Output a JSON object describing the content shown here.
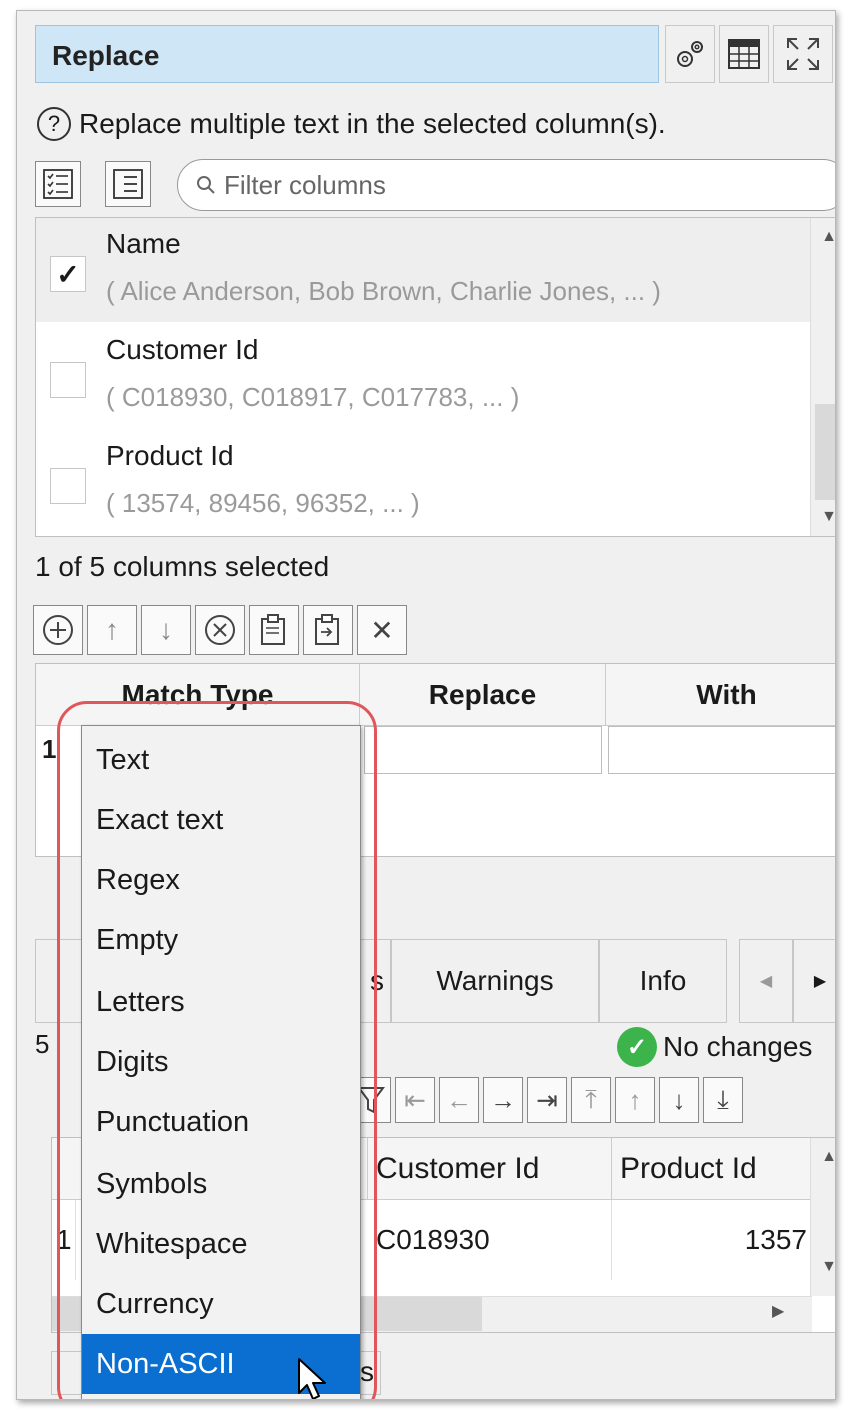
{
  "header": {
    "title": "Replace"
  },
  "help": {
    "icon": "?",
    "text": "Replace multiple text in the selected column(s)."
  },
  "filter": {
    "placeholder": "Filter columns"
  },
  "columns": [
    {
      "name": "Name",
      "sample": "( Alice Anderson, Bob Brown, Charlie Jones, ... )",
      "checked": true,
      "check_glyph": "✓"
    },
    {
      "name": "Customer Id",
      "sample": "( C018930, C018917, C017783, ... )",
      "checked": false,
      "check_glyph": ""
    },
    {
      "name": "Product Id",
      "sample": "( 13574, 89456, 96352, ... )",
      "checked": false,
      "check_glyph": ""
    }
  ],
  "selection_status": "1 of 5 columns selected",
  "rules_grid": {
    "headers": [
      "Match Type",
      "Replace",
      "With"
    ],
    "row_number": "1"
  },
  "tabs": [
    {
      "label": "s"
    },
    {
      "label": "Warnings"
    },
    {
      "label": "Info"
    }
  ],
  "status": {
    "count_prefix": "5",
    "no_changes": "No changes"
  },
  "data_grid": {
    "headers": [
      "Customer Id",
      "Product Id"
    ],
    "row": {
      "number": "1",
      "customer_id": "C018930",
      "product_id": "1357"
    }
  },
  "bottom_label": "s",
  "match_type_menu": {
    "items": [
      "Text",
      "Exact text",
      "Regex",
      "Empty",
      "Letters",
      "Digits",
      "Punctuation",
      "Symbols",
      "Whitespace",
      "Currency",
      "Non-ASCII"
    ],
    "highlighted": "Non-ASCII"
  },
  "colors": {
    "accent": "#0a6fd1",
    "highlight_border": "#e0575b",
    "ok_green": "#3cb44b",
    "title_bg": "#cfe6f7"
  }
}
